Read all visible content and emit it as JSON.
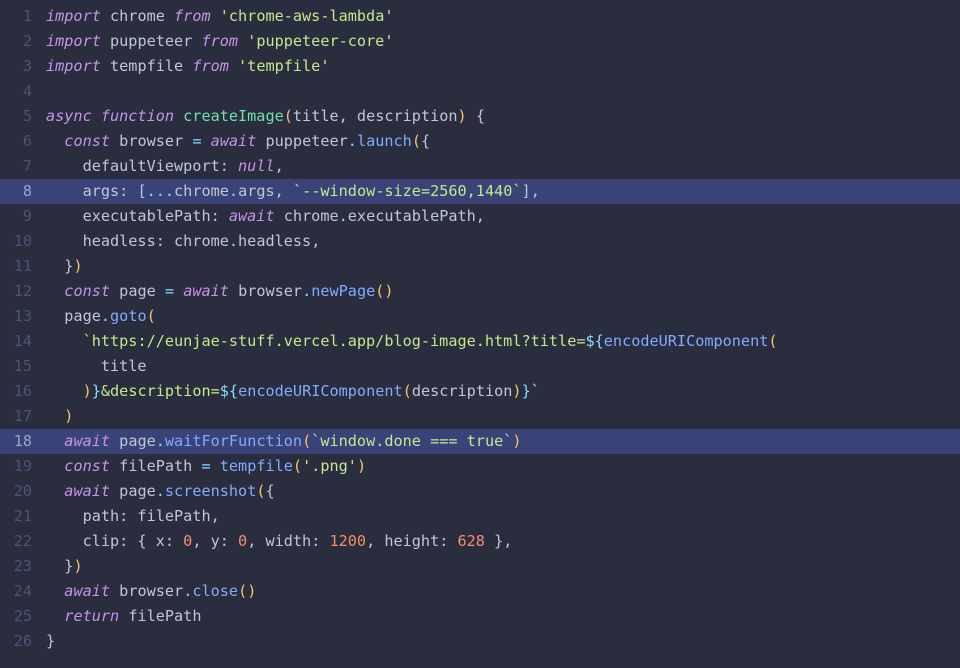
{
  "lineCount": 26,
  "highlightedLines": [
    8,
    18
  ],
  "lines": [
    [
      {
        "t": "import ",
        "c": "kw"
      },
      {
        "t": "chrome ",
        "c": "id"
      },
      {
        "t": "from ",
        "c": "kw"
      },
      {
        "t": "'chrome-aws-lambda'",
        "c": "str"
      }
    ],
    [
      {
        "t": "import ",
        "c": "kw"
      },
      {
        "t": "puppeteer ",
        "c": "id"
      },
      {
        "t": "from ",
        "c": "kw"
      },
      {
        "t": "'puppeteer-core'",
        "c": "str"
      }
    ],
    [
      {
        "t": "import ",
        "c": "kw"
      },
      {
        "t": "tempfile ",
        "c": "id"
      },
      {
        "t": "from ",
        "c": "kw"
      },
      {
        "t": "'tempfile'",
        "c": "str"
      }
    ],
    [
      {
        "t": "",
        "c": "id"
      }
    ],
    [
      {
        "t": "async function ",
        "c": "kw"
      },
      {
        "t": "createImage",
        "c": "decl"
      },
      {
        "t": "(",
        "c": "par"
      },
      {
        "t": "title",
        "c": "id"
      },
      {
        "t": ", ",
        "c": "id"
      },
      {
        "t": "description",
        "c": "id"
      },
      {
        "t": ")",
        "c": "par"
      },
      {
        "t": " {",
        "c": "id"
      }
    ],
    [
      {
        "t": "  ",
        "c": "id"
      },
      {
        "t": "const ",
        "c": "kw"
      },
      {
        "t": "browser ",
        "c": "id"
      },
      {
        "t": "= ",
        "c": "op"
      },
      {
        "t": "await ",
        "c": "kw"
      },
      {
        "t": "puppeteer",
        "c": "id"
      },
      {
        "t": ".",
        "c": "op"
      },
      {
        "t": "launch",
        "c": "fn"
      },
      {
        "t": "(",
        "c": "par"
      },
      {
        "t": "{",
        "c": "id"
      }
    ],
    [
      {
        "t": "    defaultViewport: ",
        "c": "id"
      },
      {
        "t": "null",
        "c": "kw"
      },
      {
        "t": ",",
        "c": "id"
      }
    ],
    [
      {
        "t": "    args: ",
        "c": "id"
      },
      {
        "t": "[",
        "c": "id"
      },
      {
        "t": "...",
        "c": "op"
      },
      {
        "t": "chrome",
        "c": "id"
      },
      {
        "t": ".",
        "c": "op"
      },
      {
        "t": "args",
        "c": "id"
      },
      {
        "t": ", ",
        "c": "id"
      },
      {
        "t": "`--window-size=2560,1440`",
        "c": "str"
      },
      {
        "t": "]",
        "c": "id"
      },
      {
        "t": ",",
        "c": "id"
      }
    ],
    [
      {
        "t": "    executablePath: ",
        "c": "id"
      },
      {
        "t": "await ",
        "c": "kw"
      },
      {
        "t": "chrome",
        "c": "id"
      },
      {
        "t": ".",
        "c": "op"
      },
      {
        "t": "executablePath",
        "c": "id"
      },
      {
        "t": ",",
        "c": "id"
      }
    ],
    [
      {
        "t": "    headless: chrome",
        "c": "id"
      },
      {
        "t": ".",
        "c": "op"
      },
      {
        "t": "headless",
        "c": "id"
      },
      {
        "t": ",",
        "c": "id"
      }
    ],
    [
      {
        "t": "  }",
        "c": "id"
      },
      {
        "t": ")",
        "c": "par"
      }
    ],
    [
      {
        "t": "  ",
        "c": "id"
      },
      {
        "t": "const ",
        "c": "kw"
      },
      {
        "t": "page ",
        "c": "id"
      },
      {
        "t": "= ",
        "c": "op"
      },
      {
        "t": "await ",
        "c": "kw"
      },
      {
        "t": "browser",
        "c": "id"
      },
      {
        "t": ".",
        "c": "op"
      },
      {
        "t": "newPage",
        "c": "fn"
      },
      {
        "t": "()",
        "c": "par"
      }
    ],
    [
      {
        "t": "  page",
        "c": "id"
      },
      {
        "t": ".",
        "c": "op"
      },
      {
        "t": "goto",
        "c": "fn"
      },
      {
        "t": "(",
        "c": "par"
      }
    ],
    [
      {
        "t": "    ",
        "c": "id"
      },
      {
        "t": "`https://eunjae-stuff.vercel.app/blog-image.html?title=",
        "c": "str"
      },
      {
        "t": "${",
        "c": "op"
      },
      {
        "t": "encodeURIComponent",
        "c": "fn"
      },
      {
        "t": "(",
        "c": "par"
      }
    ],
    [
      {
        "t": "      title",
        "c": "id"
      }
    ],
    [
      {
        "t": "    ",
        "c": "id"
      },
      {
        "t": ")",
        "c": "par"
      },
      {
        "t": "}",
        "c": "op"
      },
      {
        "t": "&description=",
        "c": "str"
      },
      {
        "t": "${",
        "c": "op"
      },
      {
        "t": "encodeURIComponent",
        "c": "fn"
      },
      {
        "t": "(",
        "c": "par"
      },
      {
        "t": "description",
        "c": "id"
      },
      {
        "t": ")",
        "c": "par"
      },
      {
        "t": "}",
        "c": "op"
      },
      {
        "t": "`",
        "c": "str"
      }
    ],
    [
      {
        "t": "  ",
        "c": "id"
      },
      {
        "t": ")",
        "c": "par"
      }
    ],
    [
      {
        "t": "  ",
        "c": "id"
      },
      {
        "t": "await ",
        "c": "kw"
      },
      {
        "t": "page",
        "c": "id"
      },
      {
        "t": ".",
        "c": "op"
      },
      {
        "t": "waitForFunction",
        "c": "fn"
      },
      {
        "t": "(",
        "c": "par"
      },
      {
        "t": "`window.done === true`",
        "c": "str"
      },
      {
        "t": ")",
        "c": "par"
      }
    ],
    [
      {
        "t": "  ",
        "c": "id"
      },
      {
        "t": "const ",
        "c": "kw"
      },
      {
        "t": "filePath ",
        "c": "id"
      },
      {
        "t": "= ",
        "c": "op"
      },
      {
        "t": "tempfile",
        "c": "fn"
      },
      {
        "t": "(",
        "c": "par"
      },
      {
        "t": "'.png'",
        "c": "str"
      },
      {
        "t": ")",
        "c": "par"
      }
    ],
    [
      {
        "t": "  ",
        "c": "id"
      },
      {
        "t": "await ",
        "c": "kw"
      },
      {
        "t": "page",
        "c": "id"
      },
      {
        "t": ".",
        "c": "op"
      },
      {
        "t": "screenshot",
        "c": "fn"
      },
      {
        "t": "(",
        "c": "par"
      },
      {
        "t": "{",
        "c": "id"
      }
    ],
    [
      {
        "t": "    path: filePath,",
        "c": "id"
      }
    ],
    [
      {
        "t": "    clip: { x: ",
        "c": "id"
      },
      {
        "t": "0",
        "c": "num"
      },
      {
        "t": ", y: ",
        "c": "id"
      },
      {
        "t": "0",
        "c": "num"
      },
      {
        "t": ", width: ",
        "c": "id"
      },
      {
        "t": "1200",
        "c": "num"
      },
      {
        "t": ", height: ",
        "c": "id"
      },
      {
        "t": "628",
        "c": "num"
      },
      {
        "t": " },",
        "c": "id"
      }
    ],
    [
      {
        "t": "  }",
        "c": "id"
      },
      {
        "t": ")",
        "c": "par"
      }
    ],
    [
      {
        "t": "  ",
        "c": "id"
      },
      {
        "t": "await ",
        "c": "kw"
      },
      {
        "t": "browser",
        "c": "id"
      },
      {
        "t": ".",
        "c": "op"
      },
      {
        "t": "close",
        "c": "fn"
      },
      {
        "t": "()",
        "c": "par"
      }
    ],
    [
      {
        "t": "  ",
        "c": "id"
      },
      {
        "t": "return ",
        "c": "kw"
      },
      {
        "t": "filePath",
        "c": "id"
      }
    ],
    [
      {
        "t": "}",
        "c": "id"
      }
    ]
  ]
}
